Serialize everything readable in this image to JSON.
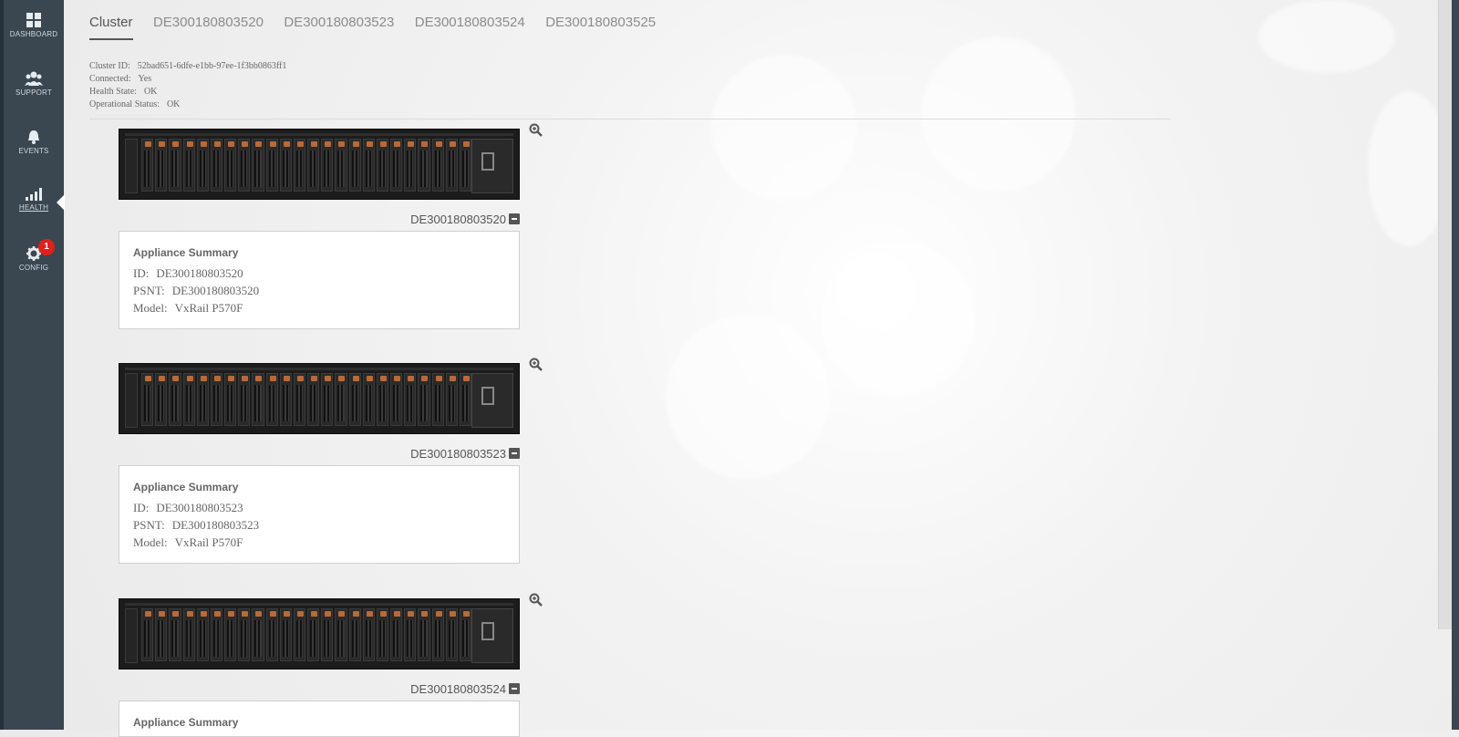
{
  "sidebar": {
    "items": [
      {
        "label": "DASHBOARD",
        "icon": "dashboard-icon"
      },
      {
        "label": "SUPPORT",
        "icon": "support-icon"
      },
      {
        "label": "EVENTS",
        "icon": "bell-icon"
      },
      {
        "label": "HEALTH",
        "icon": "health-bars-icon"
      },
      {
        "label": "CONFIG",
        "icon": "gear-icon",
        "badge": "1"
      }
    ]
  },
  "tabs": [
    {
      "label": "Cluster"
    },
    {
      "label": "DE300180803520"
    },
    {
      "label": "DE300180803523"
    },
    {
      "label": "DE300180803524"
    },
    {
      "label": "DE300180803525"
    }
  ],
  "cluster": {
    "id_label": "Cluster ID:",
    "id_value": "52bad651-6dfe-e1bb-97ee-1f3bb0863ff1",
    "connected_label": "Connected:",
    "connected_value": "Yes",
    "health_label": "Health State:",
    "health_value": "OK",
    "op_label": "Operational Status:",
    "op_value": "OK"
  },
  "appliances": [
    {
      "node_id": "DE300180803520",
      "summary_title": "Appliance Summary",
      "id_label": "ID:",
      "id": "DE300180803520",
      "psnt_label": "PSNT:",
      "psnt": "DE300180803520",
      "model_label": "Model:",
      "model": "VxRail P570F"
    },
    {
      "node_id": "DE300180803523",
      "summary_title": "Appliance Summary",
      "id_label": "ID:",
      "id": "DE300180803523",
      "psnt_label": "PSNT:",
      "psnt": "DE300180803523",
      "model_label": "Model:",
      "model": "VxRail P570F"
    },
    {
      "node_id": "DE300180803524",
      "summary_title": "Appliance Summary"
    }
  ],
  "colors": {
    "sidebar": "#3a4650",
    "badge": "#e0201a",
    "accent_text": "#555555"
  }
}
